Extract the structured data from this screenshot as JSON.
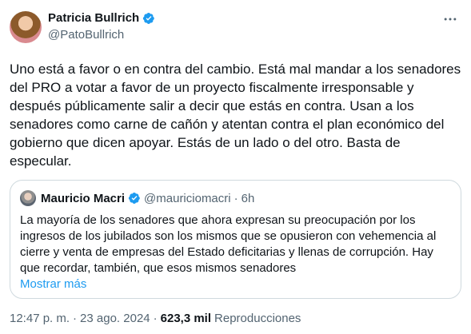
{
  "author": {
    "display_name": "Patricia Bullrich",
    "handle": "@PatoBullrich",
    "verified": true
  },
  "menu_icon": "more-horizontal-icon",
  "tweet_text": "Uno está a favor o en contra del cambio. Está mal mandar a los senadores del PRO a votar a favor de un proyecto fiscalmente irresponsable y después públicamente salir a decir que estás en contra. Usan a los senadores como carne de cañón y atentan contra el plan económico del gobierno que dicen apoyar. Estás de un lado o del otro. Basta de especular.",
  "quoted": {
    "display_name": "Mauricio Macri",
    "handle": "@mauriciomacri",
    "dot": "·",
    "time": "6h",
    "verified": true,
    "text": "La mayoría de los senadores que ahora expresan su preocupación por los ingresos de los jubilados son los mismos que se opusieron con vehemencia al cierre y venta de empresas del Estado deficitarias y llenas de corrupción. Hay que recordar, también, que esos mismos senadores",
    "show_more": "Mostrar más"
  },
  "meta": {
    "time": "12:47 p. m.",
    "sep1": "·",
    "date": "23 ago. 2024",
    "sep2": "·",
    "views": "623,3 mil",
    "views_label": "Reproducciones"
  },
  "colors": {
    "accent": "#1d9bf0",
    "secondary_text": "#536471",
    "border": "#cfd9de"
  }
}
